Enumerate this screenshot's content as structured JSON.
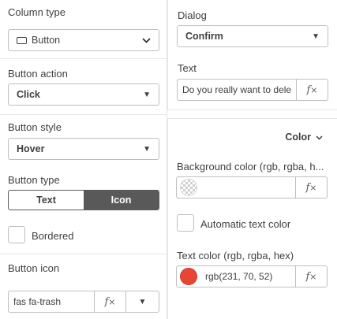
{
  "left": {
    "column_type": {
      "label": "Column type",
      "value": "Button",
      "icon": "button-shape-icon"
    },
    "button_action": {
      "label": "Button action",
      "value": "Click"
    },
    "button_style": {
      "label": "Button style",
      "value": "Hover"
    },
    "button_type": {
      "label": "Button type",
      "options": [
        "Text",
        "Icon"
      ],
      "selected": "Icon"
    },
    "bordered": {
      "label": "Bordered",
      "checked": false
    },
    "button_icon": {
      "label": "Button icon",
      "value": "fas fa-trash",
      "fx": "fx"
    }
  },
  "right": {
    "dialog": {
      "label": "Dialog",
      "value": "Confirm"
    },
    "text": {
      "label": "Text",
      "value": "Do you really want to dele",
      "fx": "fx"
    },
    "color_section": {
      "toggle_label": "Color",
      "background_color": {
        "label": "Background color (rgb, rgba, h...",
        "value": "",
        "fx": "fx"
      },
      "automatic_text_color": {
        "label": "Automatic text color",
        "checked": false
      },
      "text_color": {
        "label": "Text color (rgb, rgba, hex)",
        "value": "rgb(231, 70, 52)",
        "swatch": "#e74634",
        "fx": "fx"
      }
    }
  }
}
